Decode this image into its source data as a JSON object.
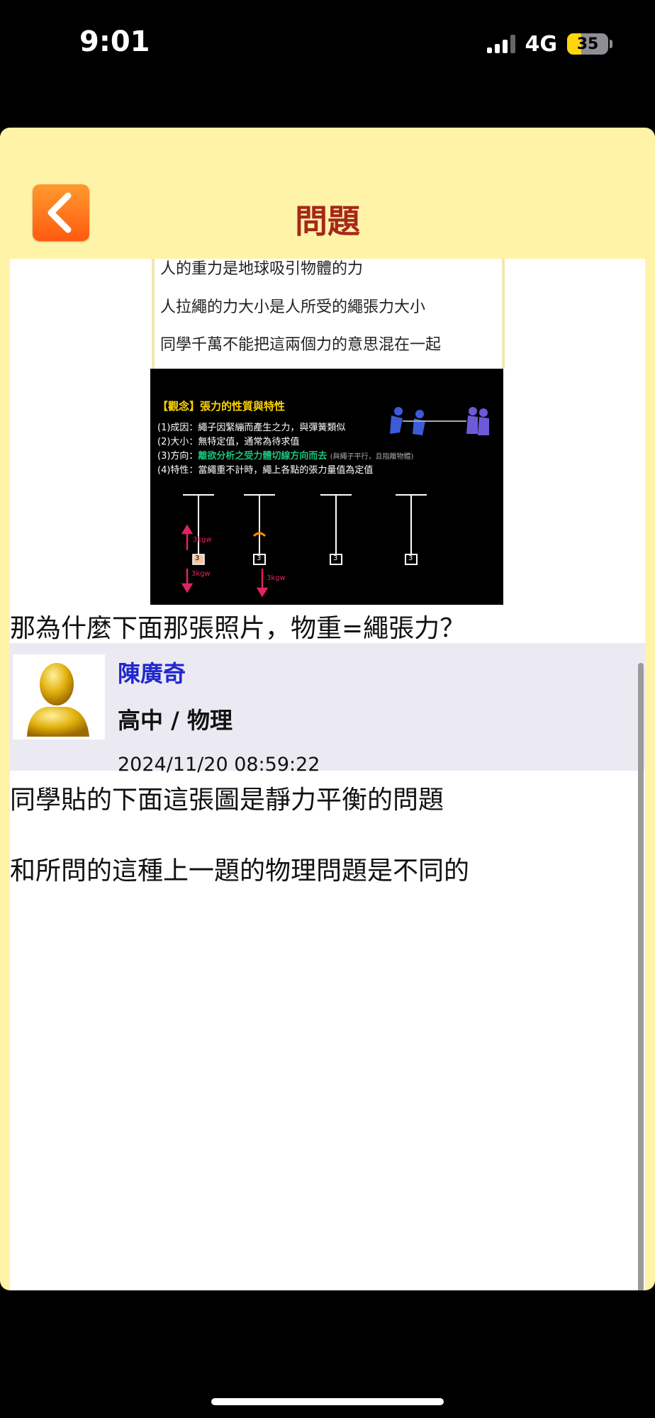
{
  "status_bar": {
    "time": "9:01",
    "network": "4G",
    "battery": "35",
    "battery_level": 0.35
  },
  "header": {
    "title": "問題",
    "back_icon": "chevron-left-icon"
  },
  "question": {
    "note_lines": [
      "人的重力是地球吸引物體的力",
      "人拉繩的力大小是人所受的繩張力大小",
      "同學千萬不能把這兩個力的意思混在一起"
    ],
    "slide": {
      "heading": "【觀念】張力的性質與特性",
      "lines": [
        "(1)成因：繩子因緊繃而產生之力，與彈簧類似",
        "(2)大小：無特定值，通常為待求值",
        "(3)方向：",
        "(4)特性：當繩重不計時，繩上各點的張力量值為定值"
      ],
      "direction_highlight": "離欲分析之受力體切線方向而去",
      "direction_note": "(與繩子平行，且指離物體)",
      "force_label_up": "3kgw",
      "force_label_down": "3kgw",
      "force_label_down_2": "3kgw",
      "block_labels": [
        "3",
        "3",
        "3",
        "3"
      ],
      "highlight_color": "#ffd400",
      "accent_green": "#19c37d",
      "force_color": "#e0245e"
    },
    "text": "那為什麼下面那張照片，物重=繩張力？"
  },
  "answer": {
    "author": "陳廣奇",
    "category": "高中 / 物理",
    "timestamp": "2024/11/20 08:59:22",
    "avatar_icon": "user-silhouette-icon",
    "lines": [
      "同學貼的下面這張圖是靜力平衡的問題",
      "和所問的這種上一題的物理問題是不同的"
    ]
  }
}
